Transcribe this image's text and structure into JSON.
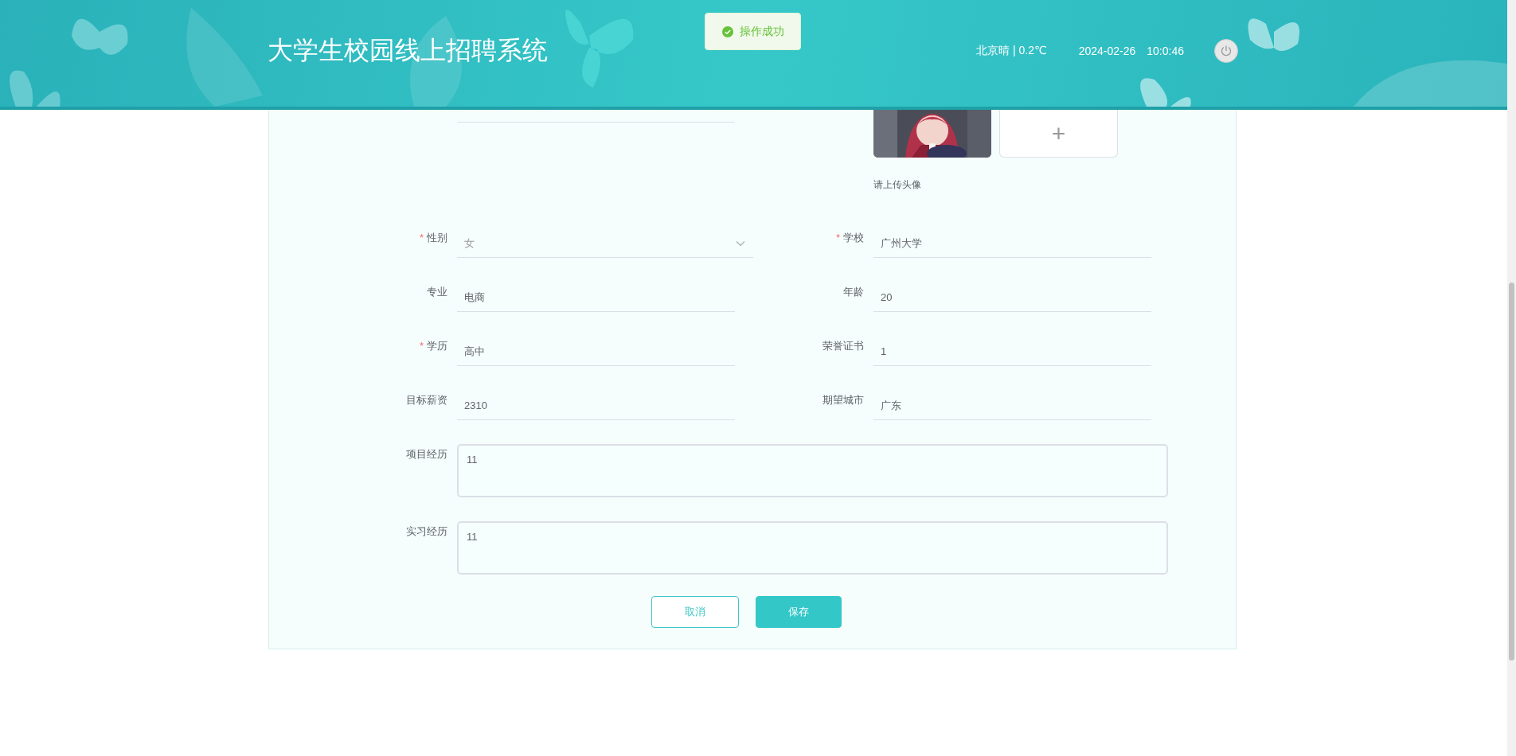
{
  "header": {
    "title": "大学生校园线上招聘系统",
    "weather": "北京晴 | 0.2℃",
    "date": "2024-02-26",
    "time": "10:0:46"
  },
  "toast": {
    "text": "操作成功",
    "kind": "success"
  },
  "required_mark": "*",
  "avatar": {
    "hint": "请上传头像",
    "upload_icon": "+"
  },
  "fields": [
    {
      "label": "性别",
      "value": "女",
      "required": true,
      "kind": "select"
    },
    {
      "label": "学校",
      "value": "广州大学",
      "required": true,
      "kind": "input"
    },
    {
      "label": "专业",
      "value": "电商",
      "required": false,
      "kind": "input"
    },
    {
      "label": "年龄",
      "value": "20",
      "required": false,
      "kind": "input"
    },
    {
      "label": "学历",
      "value": "高中",
      "required": true,
      "kind": "input"
    },
    {
      "label": "荣誉证书",
      "value": "1",
      "required": false,
      "kind": "input"
    },
    {
      "label": "目标薪资",
      "value": "2310",
      "required": false,
      "kind": "input"
    },
    {
      "label": "期望城市",
      "value": "广东",
      "required": false,
      "kind": "input"
    }
  ],
  "textareas": [
    {
      "label": "项目经历",
      "value": "11"
    },
    {
      "label": "实习经历",
      "value": "11"
    }
  ],
  "buttons": [
    {
      "label": "取消",
      "kind": "secondary"
    },
    {
      "label": "保存",
      "kind": "primary"
    }
  ]
}
